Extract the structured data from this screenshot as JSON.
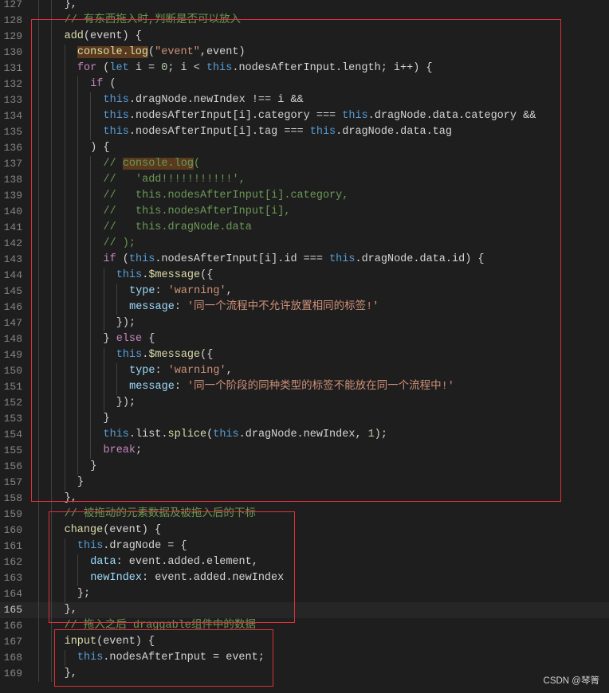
{
  "editor": {
    "current_line": 165,
    "lines": [
      {
        "n": 127,
        "indent": 2,
        "tokens": [
          {
            "t": "},",
            "c": "plain"
          }
        ]
      },
      {
        "n": 128,
        "indent": 2,
        "tokens": [
          {
            "t": "// 有东西拖入时,判断是否可以放入",
            "c": "comment"
          }
        ]
      },
      {
        "n": 129,
        "indent": 2,
        "tokens": [
          {
            "t": "add",
            "c": "func"
          },
          {
            "t": "(event) {",
            "c": "plain"
          }
        ]
      },
      {
        "n": 130,
        "indent": 3,
        "tokens": [
          {
            "t": "console.log",
            "c": "func",
            "hl": true
          },
          {
            "t": "(",
            "c": "plain"
          },
          {
            "t": "\"event\"",
            "c": "str"
          },
          {
            "t": ",event)",
            "c": "plain"
          }
        ]
      },
      {
        "n": 131,
        "indent": 3,
        "tokens": [
          {
            "t": "for",
            "c": "keyword"
          },
          {
            "t": " (",
            "c": "plain"
          },
          {
            "t": "let",
            "c": "storage"
          },
          {
            "t": " i = ",
            "c": "plain"
          },
          {
            "t": "0",
            "c": "num"
          },
          {
            "t": "; i < ",
            "c": "plain"
          },
          {
            "t": "this",
            "c": "this"
          },
          {
            "t": ".nodesAfterInput.length; i++) {",
            "c": "plain"
          }
        ]
      },
      {
        "n": 132,
        "indent": 4,
        "tokens": [
          {
            "t": "if",
            "c": "keyword"
          },
          {
            "t": " (",
            "c": "plain"
          }
        ]
      },
      {
        "n": 133,
        "indent": 5,
        "tokens": [
          {
            "t": "this",
            "c": "this"
          },
          {
            "t": ".dragNode.newIndex !== i &&",
            "c": "plain"
          }
        ]
      },
      {
        "n": 134,
        "indent": 5,
        "tokens": [
          {
            "t": "this",
            "c": "this"
          },
          {
            "t": ".nodesAfterInput[i].category === ",
            "c": "plain"
          },
          {
            "t": "this",
            "c": "this"
          },
          {
            "t": ".dragNode.data.category &&",
            "c": "plain"
          }
        ]
      },
      {
        "n": 135,
        "indent": 5,
        "tokens": [
          {
            "t": "this",
            "c": "this"
          },
          {
            "t": ".nodesAfterInput[i].tag === ",
            "c": "plain"
          },
          {
            "t": "this",
            "c": "this"
          },
          {
            "t": ".dragNode.data.tag",
            "c": "plain"
          }
        ]
      },
      {
        "n": 136,
        "indent": 4,
        "tokens": [
          {
            "t": ") {",
            "c": "plain"
          }
        ]
      },
      {
        "n": 137,
        "indent": 5,
        "tokens": [
          {
            "t": "// ",
            "c": "comment"
          },
          {
            "t": "console.log",
            "c": "comment",
            "hl": true
          },
          {
            "t": "(",
            "c": "comment"
          }
        ]
      },
      {
        "n": 138,
        "indent": 5,
        "tokens": [
          {
            "t": "//   'add!!!!!!!!!!!',",
            "c": "comment"
          }
        ]
      },
      {
        "n": 139,
        "indent": 5,
        "tokens": [
          {
            "t": "//   this.nodesAfterInput[i].category,",
            "c": "comment"
          }
        ]
      },
      {
        "n": 140,
        "indent": 5,
        "tokens": [
          {
            "t": "//   this.nodesAfterInput[i],",
            "c": "comment"
          }
        ]
      },
      {
        "n": 141,
        "indent": 5,
        "tokens": [
          {
            "t": "//   this.dragNode.data",
            "c": "comment"
          }
        ]
      },
      {
        "n": 142,
        "indent": 5,
        "tokens": [
          {
            "t": "// );",
            "c": "comment"
          }
        ]
      },
      {
        "n": 143,
        "indent": 5,
        "tokens": [
          {
            "t": "if",
            "c": "keyword"
          },
          {
            "t": " (",
            "c": "plain"
          },
          {
            "t": "this",
            "c": "this"
          },
          {
            "t": ".nodesAfterInput[i].id === ",
            "c": "plain"
          },
          {
            "t": "this",
            "c": "this"
          },
          {
            "t": ".dragNode.data.id) {",
            "c": "plain"
          }
        ]
      },
      {
        "n": 144,
        "indent": 6,
        "tokens": [
          {
            "t": "this",
            "c": "this"
          },
          {
            "t": ".",
            "c": "plain"
          },
          {
            "t": "$message",
            "c": "func"
          },
          {
            "t": "({",
            "c": "plain"
          }
        ]
      },
      {
        "n": 145,
        "indent": 7,
        "tokens": [
          {
            "t": "type",
            "c": "prop"
          },
          {
            "t": ": ",
            "c": "plain"
          },
          {
            "t": "'warning'",
            "c": "str"
          },
          {
            "t": ",",
            "c": "plain"
          }
        ]
      },
      {
        "n": 146,
        "indent": 7,
        "tokens": [
          {
            "t": "message",
            "c": "prop"
          },
          {
            "t": ": ",
            "c": "plain"
          },
          {
            "t": "'同一个流程中不允许放置相同的标签!'",
            "c": "str"
          }
        ]
      },
      {
        "n": 147,
        "indent": 6,
        "tokens": [
          {
            "t": "});",
            "c": "plain"
          }
        ]
      },
      {
        "n": 148,
        "indent": 5,
        "tokens": [
          {
            "t": "} ",
            "c": "plain"
          },
          {
            "t": "else",
            "c": "keyword"
          },
          {
            "t": " {",
            "c": "plain"
          }
        ]
      },
      {
        "n": 149,
        "indent": 6,
        "tokens": [
          {
            "t": "this",
            "c": "this"
          },
          {
            "t": ".",
            "c": "plain"
          },
          {
            "t": "$message",
            "c": "func"
          },
          {
            "t": "({",
            "c": "plain"
          }
        ]
      },
      {
        "n": 150,
        "indent": 7,
        "tokens": [
          {
            "t": "type",
            "c": "prop"
          },
          {
            "t": ": ",
            "c": "plain"
          },
          {
            "t": "'warning'",
            "c": "str"
          },
          {
            "t": ",",
            "c": "plain"
          }
        ]
      },
      {
        "n": 151,
        "indent": 7,
        "tokens": [
          {
            "t": "message",
            "c": "prop"
          },
          {
            "t": ": ",
            "c": "plain"
          },
          {
            "t": "'同一个阶段的同种类型的标签不能放在同一个流程中!'",
            "c": "str"
          }
        ]
      },
      {
        "n": 152,
        "indent": 6,
        "tokens": [
          {
            "t": "});",
            "c": "plain"
          }
        ]
      },
      {
        "n": 153,
        "indent": 5,
        "tokens": [
          {
            "t": "}",
            "c": "plain"
          }
        ]
      },
      {
        "n": 154,
        "indent": 5,
        "tokens": [
          {
            "t": "this",
            "c": "this"
          },
          {
            "t": ".list.",
            "c": "plain"
          },
          {
            "t": "splice",
            "c": "func"
          },
          {
            "t": "(",
            "c": "plain"
          },
          {
            "t": "this",
            "c": "this"
          },
          {
            "t": ".dragNode.newIndex, ",
            "c": "plain"
          },
          {
            "t": "1",
            "c": "num"
          },
          {
            "t": ");",
            "c": "plain"
          }
        ]
      },
      {
        "n": 155,
        "indent": 5,
        "tokens": [
          {
            "t": "break",
            "c": "keyword"
          },
          {
            "t": ";",
            "c": "plain"
          }
        ]
      },
      {
        "n": 156,
        "indent": 4,
        "tokens": [
          {
            "t": "}",
            "c": "plain"
          }
        ]
      },
      {
        "n": 157,
        "indent": 3,
        "tokens": [
          {
            "t": "}",
            "c": "plain"
          }
        ]
      },
      {
        "n": 158,
        "indent": 2,
        "tokens": [
          {
            "t": "},",
            "c": "plain"
          }
        ]
      },
      {
        "n": 159,
        "indent": 2,
        "tokens": [
          {
            "t": "// 被拖动的元素数据及被拖入后的下标",
            "c": "comment"
          }
        ]
      },
      {
        "n": 160,
        "indent": 2,
        "tokens": [
          {
            "t": "change",
            "c": "func"
          },
          {
            "t": "(event) {",
            "c": "plain"
          }
        ]
      },
      {
        "n": 161,
        "indent": 3,
        "tokens": [
          {
            "t": "this",
            "c": "this"
          },
          {
            "t": ".dragNode = {",
            "c": "plain"
          }
        ]
      },
      {
        "n": 162,
        "indent": 4,
        "tokens": [
          {
            "t": "data",
            "c": "prop"
          },
          {
            "t": ": event.added.element,",
            "c": "plain"
          }
        ]
      },
      {
        "n": 163,
        "indent": 4,
        "tokens": [
          {
            "t": "newIndex",
            "c": "prop"
          },
          {
            "t": ": event.added.newIndex",
            "c": "plain"
          }
        ]
      },
      {
        "n": 164,
        "indent": 3,
        "tokens": [
          {
            "t": "};",
            "c": "plain"
          }
        ]
      },
      {
        "n": 165,
        "indent": 2,
        "tokens": [
          {
            "t": "},",
            "c": "plain"
          }
        ]
      },
      {
        "n": 166,
        "indent": 2,
        "tokens": [
          {
            "t": "// 拖入之后 draggable组件中的数据",
            "c": "comment"
          }
        ]
      },
      {
        "n": 167,
        "indent": 2,
        "tokens": [
          {
            "t": "input",
            "c": "func"
          },
          {
            "t": "(event) {",
            "c": "plain"
          }
        ]
      },
      {
        "n": 168,
        "indent": 3,
        "tokens": [
          {
            "t": "this",
            "c": "this"
          },
          {
            "t": ".nodesAfterInput = event;",
            "c": "plain"
          }
        ]
      },
      {
        "n": 169,
        "indent": 2,
        "tokens": [
          {
            "t": "},",
            "c": "plain"
          }
        ]
      }
    ]
  },
  "watermark": "CSDN @琴箐"
}
